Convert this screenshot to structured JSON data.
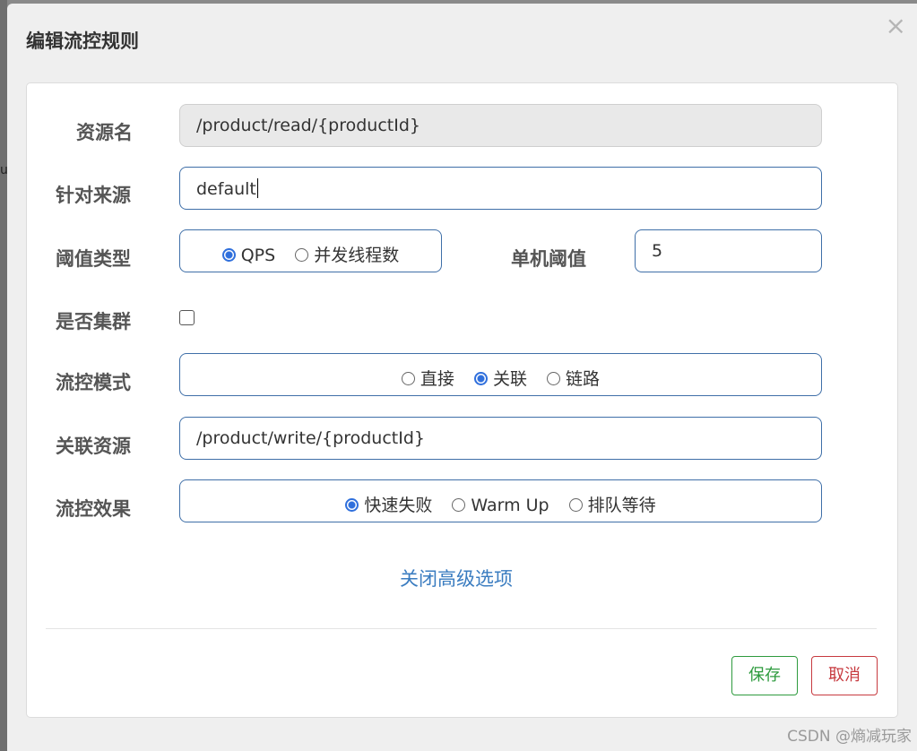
{
  "backdrop": {
    "fragment": "u"
  },
  "dialog": {
    "title": "编辑流控规则",
    "close_symbol": "×"
  },
  "form": {
    "resource_name": {
      "label": "资源名",
      "value": "/product/read/{productId}"
    },
    "limit_app": {
      "label": "针对来源",
      "value": "default"
    },
    "grade": {
      "label": "阈值类型",
      "options": [
        {
          "label": "QPS",
          "checked": true
        },
        {
          "label": "并发线程数",
          "checked": false
        }
      ]
    },
    "threshold": {
      "label": "单机阈值",
      "value": "5"
    },
    "cluster": {
      "label": "是否集群",
      "checked": false
    },
    "strategy": {
      "label": "流控模式",
      "options": [
        {
          "label": "直接",
          "checked": false
        },
        {
          "label": "关联",
          "checked": true
        },
        {
          "label": "链路",
          "checked": false
        }
      ]
    },
    "ref_resource": {
      "label": "关联资源",
      "value": "/product/write/{productId}"
    },
    "control_behavior": {
      "label": "流控效果",
      "options": [
        {
          "label": "快速失败",
          "checked": true
        },
        {
          "label": "Warm Up",
          "checked": false
        },
        {
          "label": "排队等待",
          "checked": false
        }
      ]
    },
    "advanced_link": "关闭高级选项"
  },
  "footer": {
    "save_label": "保存",
    "cancel_label": "取消"
  },
  "watermark": "CSDN @熵减玩家",
  "colors": {
    "accent": "#2f6fdc",
    "link": "#3a7cc0",
    "save": "#2e9b3e",
    "cancel": "#c73a3f"
  }
}
